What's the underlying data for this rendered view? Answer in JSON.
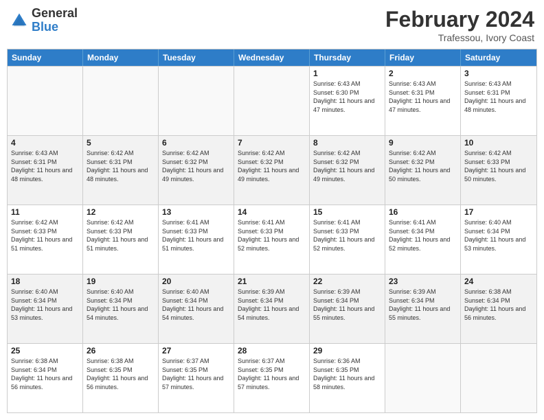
{
  "logo": {
    "general": "General",
    "blue": "Blue"
  },
  "header": {
    "month_year": "February 2024",
    "location": "Trafessou, Ivory Coast"
  },
  "days_of_week": [
    "Sunday",
    "Monday",
    "Tuesday",
    "Wednesday",
    "Thursday",
    "Friday",
    "Saturday"
  ],
  "weeks": [
    [
      {
        "day": "",
        "empty": true
      },
      {
        "day": "",
        "empty": true
      },
      {
        "day": "",
        "empty": true
      },
      {
        "day": "",
        "empty": true
      },
      {
        "day": "1",
        "sunrise": "6:43 AM",
        "sunset": "6:30 PM",
        "daylight": "11 hours and 47 minutes."
      },
      {
        "day": "2",
        "sunrise": "6:43 AM",
        "sunset": "6:31 PM",
        "daylight": "11 hours and 47 minutes."
      },
      {
        "day": "3",
        "sunrise": "6:43 AM",
        "sunset": "6:31 PM",
        "daylight": "11 hours and 48 minutes."
      }
    ],
    [
      {
        "day": "4",
        "sunrise": "6:43 AM",
        "sunset": "6:31 PM",
        "daylight": "11 hours and 48 minutes."
      },
      {
        "day": "5",
        "sunrise": "6:42 AM",
        "sunset": "6:31 PM",
        "daylight": "11 hours and 48 minutes."
      },
      {
        "day": "6",
        "sunrise": "6:42 AM",
        "sunset": "6:32 PM",
        "daylight": "11 hours and 49 minutes."
      },
      {
        "day": "7",
        "sunrise": "6:42 AM",
        "sunset": "6:32 PM",
        "daylight": "11 hours and 49 minutes."
      },
      {
        "day": "8",
        "sunrise": "6:42 AM",
        "sunset": "6:32 PM",
        "daylight": "11 hours and 49 minutes."
      },
      {
        "day": "9",
        "sunrise": "6:42 AM",
        "sunset": "6:32 PM",
        "daylight": "11 hours and 50 minutes."
      },
      {
        "day": "10",
        "sunrise": "6:42 AM",
        "sunset": "6:33 PM",
        "daylight": "11 hours and 50 minutes."
      }
    ],
    [
      {
        "day": "11",
        "sunrise": "6:42 AM",
        "sunset": "6:33 PM",
        "daylight": "11 hours and 51 minutes."
      },
      {
        "day": "12",
        "sunrise": "6:42 AM",
        "sunset": "6:33 PM",
        "daylight": "11 hours and 51 minutes."
      },
      {
        "day": "13",
        "sunrise": "6:41 AM",
        "sunset": "6:33 PM",
        "daylight": "11 hours and 51 minutes."
      },
      {
        "day": "14",
        "sunrise": "6:41 AM",
        "sunset": "6:33 PM",
        "daylight": "11 hours and 52 minutes."
      },
      {
        "day": "15",
        "sunrise": "6:41 AM",
        "sunset": "6:33 PM",
        "daylight": "11 hours and 52 minutes."
      },
      {
        "day": "16",
        "sunrise": "6:41 AM",
        "sunset": "6:34 PM",
        "daylight": "11 hours and 52 minutes."
      },
      {
        "day": "17",
        "sunrise": "6:40 AM",
        "sunset": "6:34 PM",
        "daylight": "11 hours and 53 minutes."
      }
    ],
    [
      {
        "day": "18",
        "sunrise": "6:40 AM",
        "sunset": "6:34 PM",
        "daylight": "11 hours and 53 minutes."
      },
      {
        "day": "19",
        "sunrise": "6:40 AM",
        "sunset": "6:34 PM",
        "daylight": "11 hours and 54 minutes."
      },
      {
        "day": "20",
        "sunrise": "6:40 AM",
        "sunset": "6:34 PM",
        "daylight": "11 hours and 54 minutes."
      },
      {
        "day": "21",
        "sunrise": "6:39 AM",
        "sunset": "6:34 PM",
        "daylight": "11 hours and 54 minutes."
      },
      {
        "day": "22",
        "sunrise": "6:39 AM",
        "sunset": "6:34 PM",
        "daylight": "11 hours and 55 minutes."
      },
      {
        "day": "23",
        "sunrise": "6:39 AM",
        "sunset": "6:34 PM",
        "daylight": "11 hours and 55 minutes."
      },
      {
        "day": "24",
        "sunrise": "6:38 AM",
        "sunset": "6:34 PM",
        "daylight": "11 hours and 56 minutes."
      }
    ],
    [
      {
        "day": "25",
        "sunrise": "6:38 AM",
        "sunset": "6:34 PM",
        "daylight": "11 hours and 56 minutes."
      },
      {
        "day": "26",
        "sunrise": "6:38 AM",
        "sunset": "6:35 PM",
        "daylight": "11 hours and 56 minutes."
      },
      {
        "day": "27",
        "sunrise": "6:37 AM",
        "sunset": "6:35 PM",
        "daylight": "11 hours and 57 minutes."
      },
      {
        "day": "28",
        "sunrise": "6:37 AM",
        "sunset": "6:35 PM",
        "daylight": "11 hours and 57 minutes."
      },
      {
        "day": "29",
        "sunrise": "6:36 AM",
        "sunset": "6:35 PM",
        "daylight": "11 hours and 58 minutes."
      },
      {
        "day": "",
        "empty": true
      },
      {
        "day": "",
        "empty": true
      }
    ]
  ]
}
